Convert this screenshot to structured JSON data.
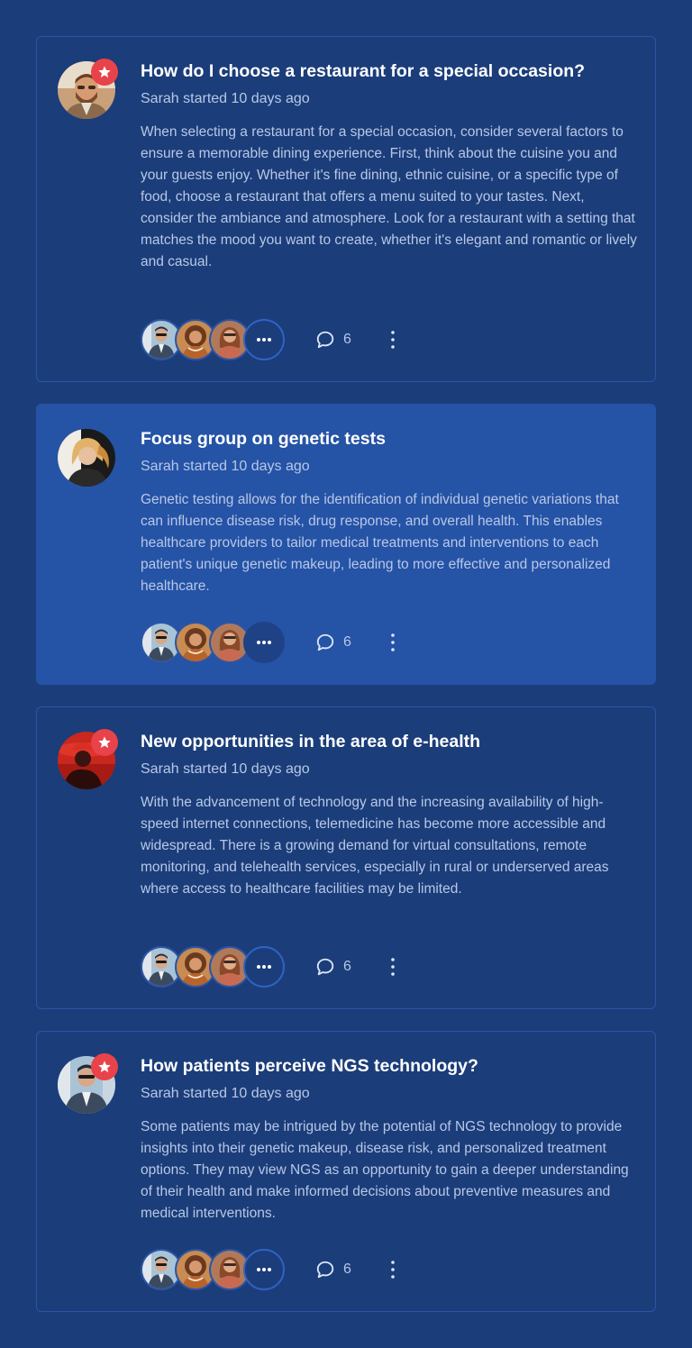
{
  "colors": {
    "background": "#1b3d7a",
    "card_border": "#2b55a6",
    "card_active": "#2553a6",
    "badge": "#e8434a",
    "title": "#ffffff",
    "text_muted": "#b8c8e6"
  },
  "posts": [
    {
      "title": "How do I choose a restaurant for a special occasion?",
      "meta": "Sarah started 10 days ago",
      "body": "When selecting a restaurant for a special occasion, consider several factors to ensure a memorable dining experience. First, think about the cuisine you and your guests enjoy. Whether it's fine dining, ethnic cuisine, or a specific type of food, choose a restaurant that offers a menu suited to your tastes. Next, consider the ambiance and atmosphere. Look for a restaurant with a setting that matches the mood you want to create, whether it's elegant and romantic or lively and casual.",
      "comment_count": "6",
      "starred": true,
      "active": false,
      "avatar_icon": "bearded-man-avatar"
    },
    {
      "title": "Focus group on genetic tests",
      "meta": "Sarah started 10 days ago",
      "body": "Genetic testing allows for the identification of individual genetic variations that can influence disease risk, drug response, and overall health. This enables healthcare providers to tailor medical treatments and interventions to each patient's unique genetic makeup, leading to more effective and personalized healthcare.",
      "comment_count": "6",
      "starred": false,
      "active": true,
      "avatar_icon": "blonde-woman-avatar"
    },
    {
      "title": "New opportunities in the area of e-health",
      "meta": "Sarah started 10 days ago",
      "body": "With the advancement of technology and the increasing availability of high-speed internet connections, telemedicine has become more accessible and widespread. There is a growing demand for virtual consultations, remote monitoring, and telehealth services, especially in rural or underserved areas where access to healthcare facilities may be limited.",
      "comment_count": "6",
      "starred": true,
      "active": false,
      "avatar_icon": "woman-red-hat-avatar"
    },
    {
      "title": "How patients perceive NGS technology?",
      "meta": "Sarah started 10 days ago",
      "body": "Some patients may be intrigued by the potential of NGS technology to provide insights into their genetic makeup, disease risk, and personalized treatment options. They may view NGS as an opportunity to gain a deeper understanding of their health and make informed decisions about preventive measures and medical interventions.",
      "comment_count": "6",
      "starred": true,
      "active": false,
      "avatar_icon": "man-suit-avatar"
    }
  ],
  "participant_icons": [
    "man-suit-avatar",
    "curly-woman-avatar",
    "woman-sunglasses-avatar"
  ],
  "icons": {
    "star": "star-icon",
    "more": "more-horizontal-icon",
    "comment": "comment-bubble-icon",
    "menu": "more-vertical-icon"
  }
}
